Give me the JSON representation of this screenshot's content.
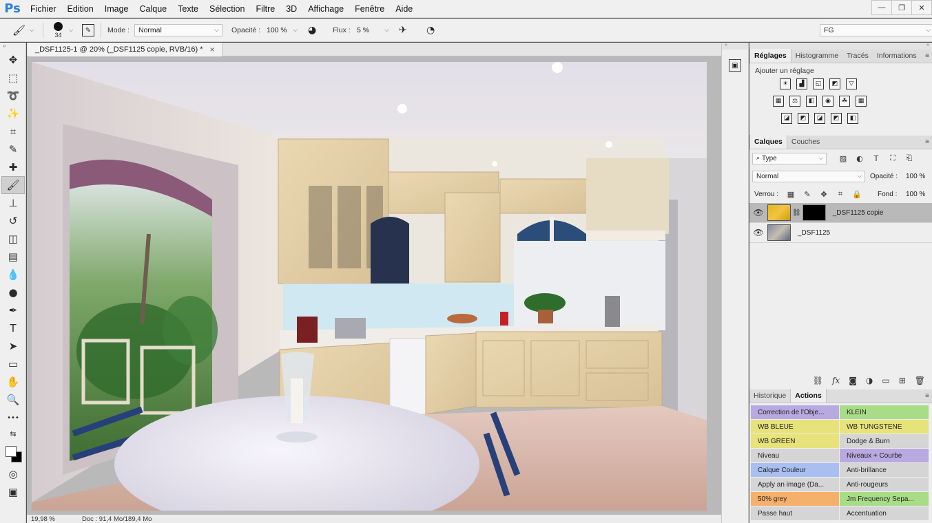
{
  "menubar": {
    "logo": "Ps",
    "items": [
      "Fichier",
      "Edition",
      "Image",
      "Calque",
      "Texte",
      "Sélection",
      "Filtre",
      "3D",
      "Affichage",
      "Fenêtre",
      "Aide"
    ],
    "minimize": "—",
    "restore": "❐",
    "close": "✕"
  },
  "options": {
    "brush_size": "34",
    "mode_label": "Mode :",
    "mode_value": "Normal",
    "opacity_label": "Opacité :",
    "opacity_value": "100 %",
    "flow_label": "Flux :",
    "flow_value": "5 %",
    "workspace_value": "FG"
  },
  "toolbar": {
    "tools": [
      {
        "name": "move-tool",
        "glyph": "✥"
      },
      {
        "name": "marquee-tool",
        "glyph": "⬚"
      },
      {
        "name": "lasso-tool",
        "glyph": "➰"
      },
      {
        "name": "magic-wand-tool",
        "glyph": "✨"
      },
      {
        "name": "crop-tool",
        "glyph": "⌗"
      },
      {
        "name": "eyedropper-tool",
        "glyph": "✎"
      },
      {
        "name": "healing-brush-tool",
        "glyph": "✚"
      },
      {
        "name": "brush-tool",
        "glyph": "🖌"
      },
      {
        "name": "clone-stamp-tool",
        "glyph": "⊥"
      },
      {
        "name": "history-brush-tool",
        "glyph": "↺"
      },
      {
        "name": "eraser-tool",
        "glyph": "◫"
      },
      {
        "name": "gradient-tool",
        "glyph": "▤"
      },
      {
        "name": "blur-tool",
        "glyph": "💧"
      },
      {
        "name": "dodge-tool",
        "glyph": "●"
      },
      {
        "name": "pen-tool",
        "glyph": "✒"
      },
      {
        "name": "type-tool",
        "glyph": "T"
      },
      {
        "name": "path-selection-tool",
        "glyph": "➤"
      },
      {
        "name": "rectangle-tool",
        "glyph": "▭"
      },
      {
        "name": "hand-tool",
        "glyph": "✋"
      },
      {
        "name": "zoom-tool",
        "glyph": "🔍"
      },
      {
        "name": "more-tools",
        "glyph": "•••"
      }
    ]
  },
  "document": {
    "tab_title": "_DSF1125-1 @ 20% (_DSF1125 copie, RVB/16) *",
    "tab_close": "×",
    "zoom": "19,98 %",
    "doc_info": "Doc : 91,4 Mo/189,4 Mo"
  },
  "adjust_panel": {
    "tabs": [
      "Réglages",
      "Histogramme",
      "Tracés",
      "Informations"
    ],
    "title": "Ajouter un réglage",
    "row1": [
      "☀",
      "▟",
      "◱",
      "◩",
      "▽"
    ],
    "row2": [
      "▦",
      "⚖",
      "◧",
      "◉",
      "☘",
      "▦"
    ],
    "row3": [
      "◪",
      "◩",
      "◪",
      "◩",
      "◧"
    ]
  },
  "layers_panel": {
    "tabs": [
      "Calques",
      "Couches"
    ],
    "filter_value": "Type",
    "blend_value": "Normal",
    "opacity_label": "Opacité :",
    "opacity_value": "100 %",
    "lock_label": "Verrou :",
    "fill_label": "Fond :",
    "fill_value": "100 %",
    "layers": [
      {
        "name": "_DSF1125 copie",
        "visible_label": "Yeux",
        "selected": true
      },
      {
        "name": "_DSF1125",
        "visible_label": "Yeux",
        "selected": false
      }
    ],
    "visibility_header": "Yeux"
  },
  "actions_panel": {
    "tabs": [
      "Historique",
      "Actions"
    ],
    "colors": {
      "purple": "#b8a9e0",
      "green": "#a9dc87",
      "yellow": "#e7e27a",
      "gray": "#d5d5d5",
      "blue": "#a9bff1",
      "orange": "#f5b06c",
      "red": "#f08a8a"
    },
    "buttons": [
      {
        "label": "Correction de l'Obje...",
        "color": "purple"
      },
      {
        "label": "KLEIN",
        "color": "green"
      },
      {
        "label": "WB BLEUE",
        "color": "yellow"
      },
      {
        "label": "WB TUNGSTENE",
        "color": "yellow"
      },
      {
        "label": "WB GREEN",
        "color": "yellow"
      },
      {
        "label": "Dodge & Burn",
        "color": "gray"
      },
      {
        "label": "Niveau",
        "color": "gray"
      },
      {
        "label": "Niveaux + Courbe",
        "color": "purple"
      },
      {
        "label": "Calque Couleur",
        "color": "blue"
      },
      {
        "label": "Anti-brillance",
        "color": "gray"
      },
      {
        "label": "Apply an image (Da...",
        "color": "gray"
      },
      {
        "label": "Anti-rougeurs",
        "color": "gray"
      },
      {
        "label": "50% grey",
        "color": "orange"
      },
      {
        "label": "Jm Frequency Sepa...",
        "color": "green"
      },
      {
        "label": "Passe haut",
        "color": "gray"
      },
      {
        "label": "Accentuation",
        "color": "gray"
      }
    ]
  }
}
